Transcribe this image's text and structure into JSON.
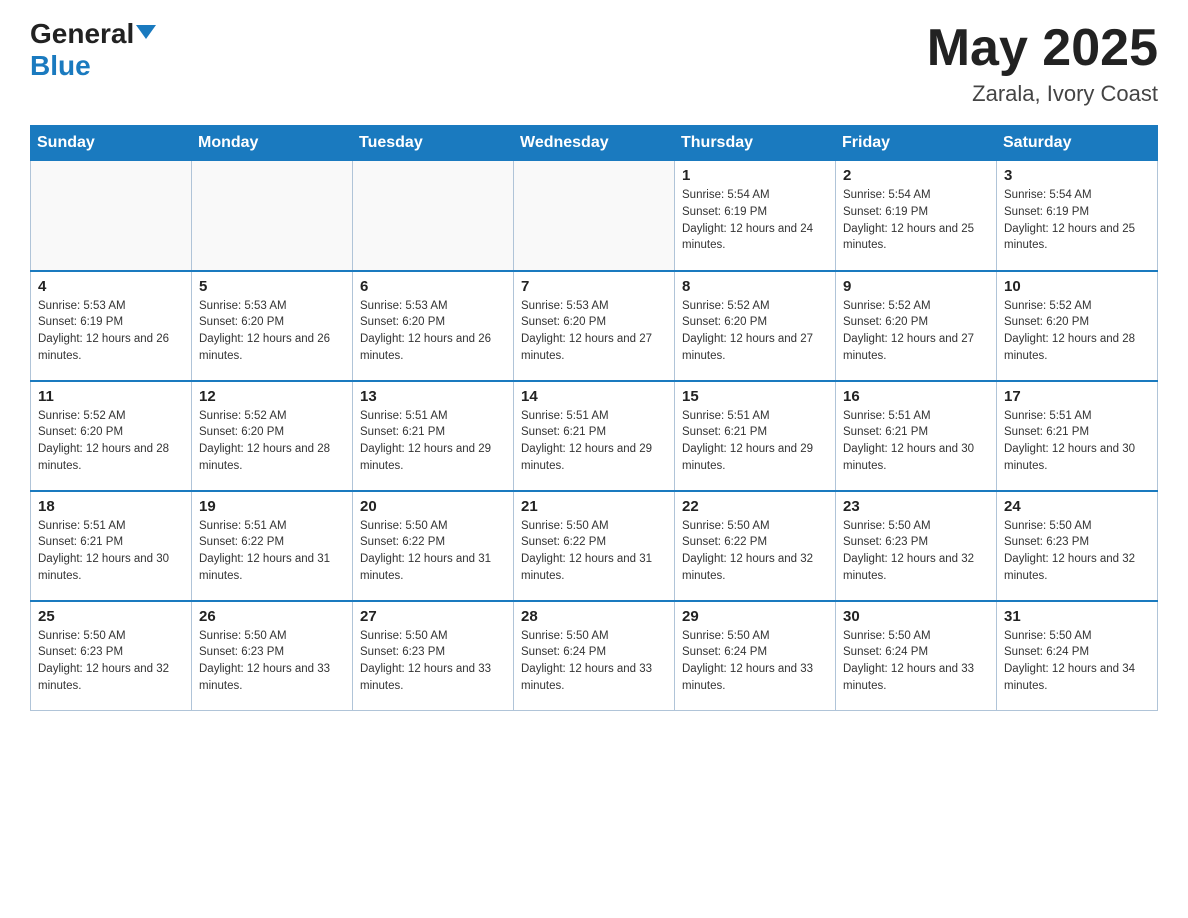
{
  "header": {
    "logo_general": "General",
    "logo_blue": "Blue",
    "month_title": "May 2025",
    "location": "Zarala, Ivory Coast"
  },
  "weekdays": [
    "Sunday",
    "Monday",
    "Tuesday",
    "Wednesday",
    "Thursday",
    "Friday",
    "Saturday"
  ],
  "weeks": [
    [
      {
        "day": "",
        "info": ""
      },
      {
        "day": "",
        "info": ""
      },
      {
        "day": "",
        "info": ""
      },
      {
        "day": "",
        "info": ""
      },
      {
        "day": "1",
        "info": "Sunrise: 5:54 AM\nSunset: 6:19 PM\nDaylight: 12 hours and 24 minutes."
      },
      {
        "day": "2",
        "info": "Sunrise: 5:54 AM\nSunset: 6:19 PM\nDaylight: 12 hours and 25 minutes."
      },
      {
        "day": "3",
        "info": "Sunrise: 5:54 AM\nSunset: 6:19 PM\nDaylight: 12 hours and 25 minutes."
      }
    ],
    [
      {
        "day": "4",
        "info": "Sunrise: 5:53 AM\nSunset: 6:19 PM\nDaylight: 12 hours and 26 minutes."
      },
      {
        "day": "5",
        "info": "Sunrise: 5:53 AM\nSunset: 6:20 PM\nDaylight: 12 hours and 26 minutes."
      },
      {
        "day": "6",
        "info": "Sunrise: 5:53 AM\nSunset: 6:20 PM\nDaylight: 12 hours and 26 minutes."
      },
      {
        "day": "7",
        "info": "Sunrise: 5:53 AM\nSunset: 6:20 PM\nDaylight: 12 hours and 27 minutes."
      },
      {
        "day": "8",
        "info": "Sunrise: 5:52 AM\nSunset: 6:20 PM\nDaylight: 12 hours and 27 minutes."
      },
      {
        "day": "9",
        "info": "Sunrise: 5:52 AM\nSunset: 6:20 PM\nDaylight: 12 hours and 27 minutes."
      },
      {
        "day": "10",
        "info": "Sunrise: 5:52 AM\nSunset: 6:20 PM\nDaylight: 12 hours and 28 minutes."
      }
    ],
    [
      {
        "day": "11",
        "info": "Sunrise: 5:52 AM\nSunset: 6:20 PM\nDaylight: 12 hours and 28 minutes."
      },
      {
        "day": "12",
        "info": "Sunrise: 5:52 AM\nSunset: 6:20 PM\nDaylight: 12 hours and 28 minutes."
      },
      {
        "day": "13",
        "info": "Sunrise: 5:51 AM\nSunset: 6:21 PM\nDaylight: 12 hours and 29 minutes."
      },
      {
        "day": "14",
        "info": "Sunrise: 5:51 AM\nSunset: 6:21 PM\nDaylight: 12 hours and 29 minutes."
      },
      {
        "day": "15",
        "info": "Sunrise: 5:51 AM\nSunset: 6:21 PM\nDaylight: 12 hours and 29 minutes."
      },
      {
        "day": "16",
        "info": "Sunrise: 5:51 AM\nSunset: 6:21 PM\nDaylight: 12 hours and 30 minutes."
      },
      {
        "day": "17",
        "info": "Sunrise: 5:51 AM\nSunset: 6:21 PM\nDaylight: 12 hours and 30 minutes."
      }
    ],
    [
      {
        "day": "18",
        "info": "Sunrise: 5:51 AM\nSunset: 6:21 PM\nDaylight: 12 hours and 30 minutes."
      },
      {
        "day": "19",
        "info": "Sunrise: 5:51 AM\nSunset: 6:22 PM\nDaylight: 12 hours and 31 minutes."
      },
      {
        "day": "20",
        "info": "Sunrise: 5:50 AM\nSunset: 6:22 PM\nDaylight: 12 hours and 31 minutes."
      },
      {
        "day": "21",
        "info": "Sunrise: 5:50 AM\nSunset: 6:22 PM\nDaylight: 12 hours and 31 minutes."
      },
      {
        "day": "22",
        "info": "Sunrise: 5:50 AM\nSunset: 6:22 PM\nDaylight: 12 hours and 32 minutes."
      },
      {
        "day": "23",
        "info": "Sunrise: 5:50 AM\nSunset: 6:23 PM\nDaylight: 12 hours and 32 minutes."
      },
      {
        "day": "24",
        "info": "Sunrise: 5:50 AM\nSunset: 6:23 PM\nDaylight: 12 hours and 32 minutes."
      }
    ],
    [
      {
        "day": "25",
        "info": "Sunrise: 5:50 AM\nSunset: 6:23 PM\nDaylight: 12 hours and 32 minutes."
      },
      {
        "day": "26",
        "info": "Sunrise: 5:50 AM\nSunset: 6:23 PM\nDaylight: 12 hours and 33 minutes."
      },
      {
        "day": "27",
        "info": "Sunrise: 5:50 AM\nSunset: 6:23 PM\nDaylight: 12 hours and 33 minutes."
      },
      {
        "day": "28",
        "info": "Sunrise: 5:50 AM\nSunset: 6:24 PM\nDaylight: 12 hours and 33 minutes."
      },
      {
        "day": "29",
        "info": "Sunrise: 5:50 AM\nSunset: 6:24 PM\nDaylight: 12 hours and 33 minutes."
      },
      {
        "day": "30",
        "info": "Sunrise: 5:50 AM\nSunset: 6:24 PM\nDaylight: 12 hours and 33 minutes."
      },
      {
        "day": "31",
        "info": "Sunrise: 5:50 AM\nSunset: 6:24 PM\nDaylight: 12 hours and 34 minutes."
      }
    ]
  ]
}
